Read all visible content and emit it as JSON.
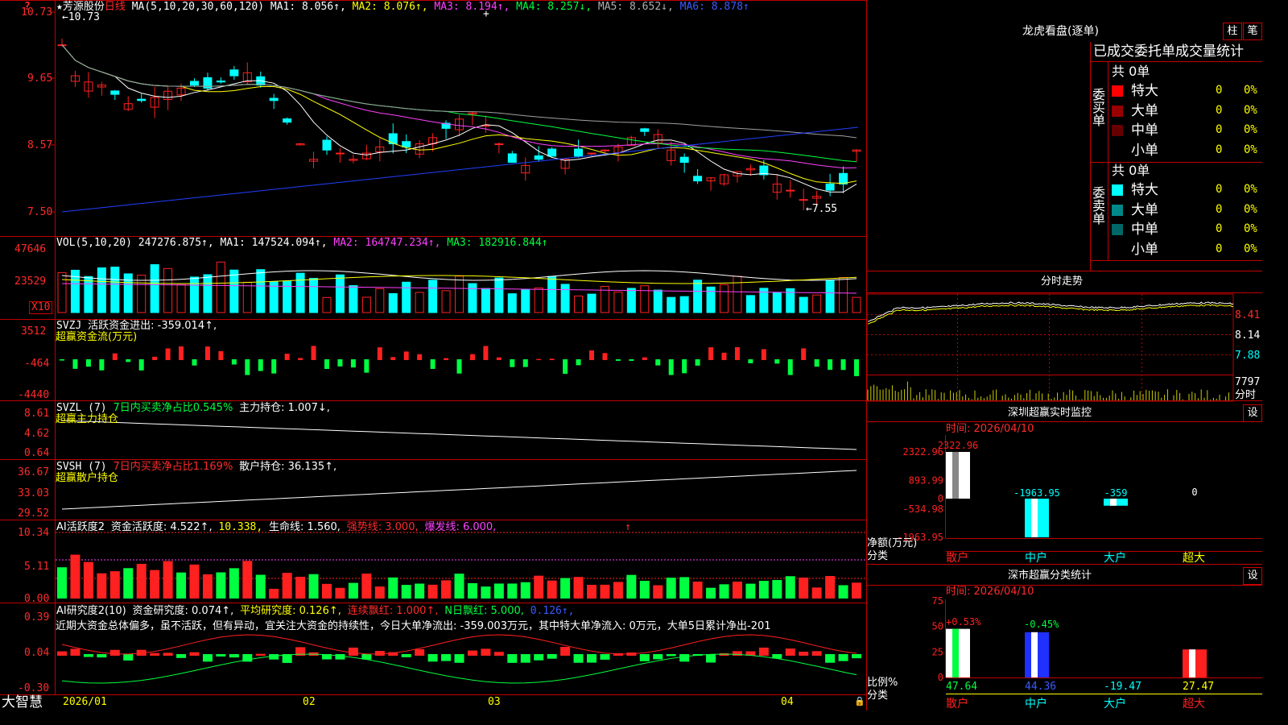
{
  "stock_name": "芳源股份",
  "period": "日线",
  "brand": "大智慧",
  "dates": [
    "2026/01",
    "02",
    "03",
    "04"
  ],
  "main": {
    "ma_label": "MA(5,10,20,30,60,120)",
    "ma1": "MA1: 8.056↑,",
    "ma2": "MA2: 8.076↑,",
    "ma3": "MA3: 8.194↑,",
    "ma4": "MA4: 8.257↓,",
    "ma5": "MA5: 8.652↓,",
    "ma6": "MA6: 8.878↑",
    "y_ticks": [
      "10.73",
      "9.65",
      "8.57",
      "7.50"
    ],
    "high_mark": "10.73",
    "low_mark": "7.55"
  },
  "vol": {
    "label": "VOL(5,10,20)",
    "value": "247276.875↑,",
    "ma1": "MA1: 147524.094↑,",
    "ma2": "MA2: 164747.234↑,",
    "ma3": "MA3: 182916.844↑",
    "y_ticks": [
      "47646",
      "23529"
    ],
    "unit": "X10"
  },
  "svzj": {
    "label": "SVZJ",
    "line": "活跃资金进出: -359.014↑,",
    "sub": "超赢资金流(万元)",
    "y_ticks": [
      "3512",
      "-464",
      "-4440"
    ]
  },
  "svzl": {
    "label": "SVZL (7)",
    "ratio": "7日内买卖净占比0.545%",
    "hold": "主力持仓: 1.007↓,",
    "sub": "超赢主力持仓",
    "y_ticks": [
      "8.61",
      "4.62",
      "0.64"
    ]
  },
  "svsh": {
    "label": "SVSH (7)",
    "ratio": "7日内买卖净占比1.169%",
    "hold": "散户持仓: 36.135↑,",
    "sub": "超赢散户持仓",
    "y_ticks": [
      "36.67",
      "33.03",
      "29.52"
    ]
  },
  "ai1": {
    "label": "AI活跃度2",
    "a": "资金活跃度: 4.522↑,",
    "b": "10.338,",
    "c": "生命线: 1.560,",
    "d": "强势线: 3.000,",
    "e": "爆发线: 6.000,",
    "y_ticks": [
      "10.34",
      "5.11",
      "0.00"
    ]
  },
  "ai2": {
    "label": "AI研究度2(10)",
    "a": "资金研究度: 0.074↑,",
    "b": "平均研究度: 0.126↑,",
    "c": "连续飘红: 1.000↑,",
    "d": "N日飘红: 5.000,",
    "e": "0.126↑,",
    "note": "近期大资金总体偏多，虽不活跃，但有异动，宜关注大资金的持续性，今日大单净流出: -359.003万元，其中特大单净流入: 0万元，大单5日累计净出-201",
    "y_ticks": [
      "0.39",
      "0.04",
      "-0.30"
    ]
  },
  "dragon": {
    "title": "龙虎看盘(逐单)",
    "btn1": "柱",
    "btn2": "笔",
    "header": "已成交委托单成交量统计",
    "buy_label": "委买单",
    "sell_label": "委卖单",
    "buy_total": "共 0单",
    "sell_total": "共 0单",
    "buy_rows": [
      {
        "name": "特大",
        "vol": "0",
        "pct": "0%",
        "color": "#ff0000"
      },
      {
        "name": "大单",
        "vol": "0",
        "pct": "0%",
        "color": "#990000"
      },
      {
        "name": "中单",
        "vol": "0",
        "pct": "0%",
        "color": "#660000"
      },
      {
        "name": "小单",
        "vol": "0",
        "pct": "0%",
        "color": "#000000"
      }
    ],
    "sell_rows": [
      {
        "name": "特大",
        "vol": "0",
        "pct": "0%",
        "color": "#00ffff"
      },
      {
        "name": "大单",
        "vol": "0",
        "pct": "0%",
        "color": "#008888"
      },
      {
        "name": "中单",
        "vol": "0",
        "pct": "0%",
        "color": "#006666"
      },
      {
        "name": "小单",
        "vol": "0",
        "pct": "0%",
        "color": "#000000"
      }
    ]
  },
  "intraday": {
    "title": "分时走势",
    "y_ticks": [
      "8.41",
      "8.14",
      "7.88"
    ],
    "vol_tick": "7797",
    "foot": "分时"
  },
  "sz_monitor": {
    "title": "深圳超赢实时监控",
    "btn": "设",
    "time": "时间: 2026/04/10",
    "y_ticks": [
      "2322.96",
      "893.99",
      "0",
      "-534.98",
      "-1963.95"
    ],
    "ylabel1": "净额(万元)",
    "ylabel2": "分类"
  },
  "sz_stats": {
    "title": "深市超赢分类统计",
    "btn": "设",
    "time": "时间: 2026/04/10",
    "y_ticks": [
      "75",
      "50",
      "25",
      "0"
    ],
    "ylabel1": "比例%",
    "ylabel2": "分类"
  },
  "chart_data": [
    {
      "type": "bar",
      "title": "深圳超赢实时监控",
      "categories": [
        "散户",
        "中户",
        "大户",
        "超大"
      ],
      "values": [
        2322.96,
        -1963.95,
        -359,
        0
      ],
      "value_labels": [
        "2322.96",
        "-1963.95",
        "-359",
        "0"
      ],
      "ylabel": "净额(万元)",
      "xlabel": "分类",
      "ylim": [
        -1963.95,
        2322.96
      ]
    },
    {
      "type": "bar",
      "title": "深市超赢分类统计",
      "categories": [
        "散户",
        "中户",
        "大户",
        "超大"
      ],
      "series": [
        {
          "values": [
            47.64,
            44.36,
            0,
            27.47
          ]
        }
      ],
      "bottom_labels": [
        "47.64",
        "44.36",
        "-19.47",
        "27.47"
      ],
      "top_labels": [
        "+0.53%",
        "-0.45%"
      ],
      "ylabel": "比例%",
      "xlabel": "分类",
      "ylim": [
        0,
        75
      ]
    }
  ]
}
